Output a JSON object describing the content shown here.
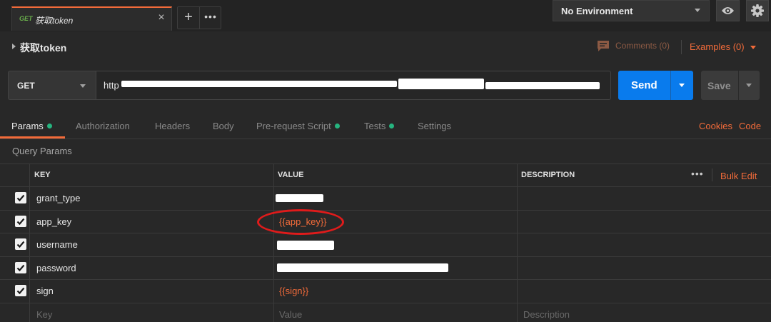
{
  "tab": {
    "method": "GET",
    "name": "获取token",
    "close": "×"
  },
  "tab_controls": {
    "add": "+",
    "more": "•••"
  },
  "environment": {
    "selected": "No Environment"
  },
  "request": {
    "title": "获取token",
    "comments_label": "Comments (0)",
    "examples_label": "Examples (0)",
    "method": "GET",
    "url": "http"
  },
  "actions": {
    "send": "Send",
    "save": "Save"
  },
  "subtabs": {
    "params": "Params",
    "authorization": "Authorization",
    "headers": "Headers",
    "body": "Body",
    "prerequest": "Pre-request Script",
    "tests": "Tests",
    "settings": "Settings",
    "cookies": "Cookies",
    "code": "Code"
  },
  "query_params": {
    "section_label": "Query Params",
    "columns": {
      "key": "KEY",
      "value": "VALUE",
      "description": "DESCRIPTION"
    },
    "more": "•••",
    "bulk_edit": "Bulk Edit",
    "rows": [
      {
        "key": "grant_type",
        "value": "",
        "checked": true
      },
      {
        "key": "app_key",
        "value": "{{app_key}}",
        "checked": true
      },
      {
        "key": "username",
        "value": "",
        "checked": true
      },
      {
        "key": "password",
        "value": "",
        "checked": true
      },
      {
        "key": "sign",
        "value": "{{sign}}",
        "checked": true
      }
    ],
    "placeholders": {
      "key": "Key",
      "value": "Value",
      "description": "Description"
    }
  },
  "colors": {
    "accent": "#f26b3a",
    "send_blue": "#097bed",
    "status_green": "#26b47f",
    "annotation_red": "#e01b1b"
  }
}
